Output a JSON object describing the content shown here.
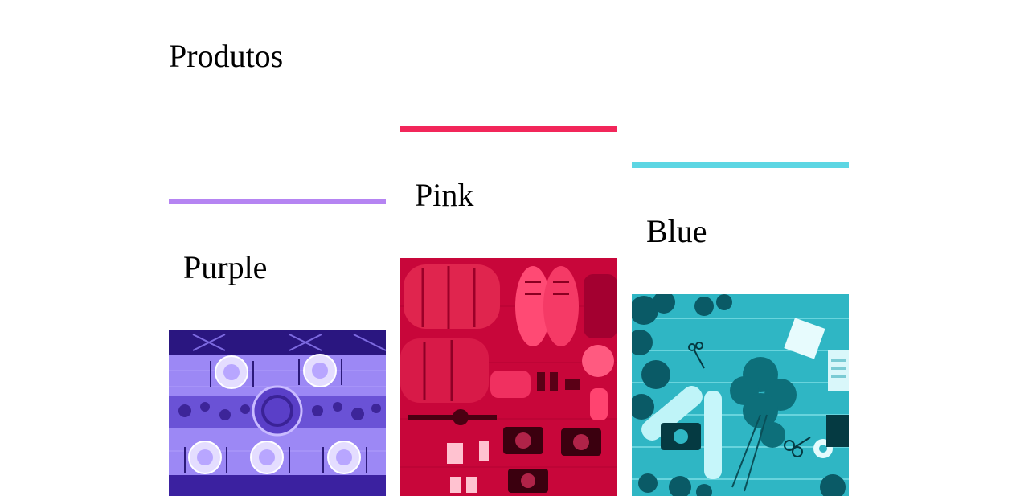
{
  "page": {
    "title": "Produtos"
  },
  "cards": [
    {
      "label": "Purple",
      "accent": "#b584f2",
      "image": "table-setting-photo",
      "tint": [
        "#2a0f8a",
        "#b9a4ff"
      ]
    },
    {
      "label": "Pink",
      "accent": "#f2265a",
      "image": "travel-gear-photo",
      "tint": [
        "#7a0020",
        "#ff3a6e"
      ]
    },
    {
      "label": "Blue",
      "accent": "#5dd6e3",
      "image": "flowers-desk-photo",
      "tint": [
        "#005c6b",
        "#8ff0f7"
      ]
    }
  ]
}
